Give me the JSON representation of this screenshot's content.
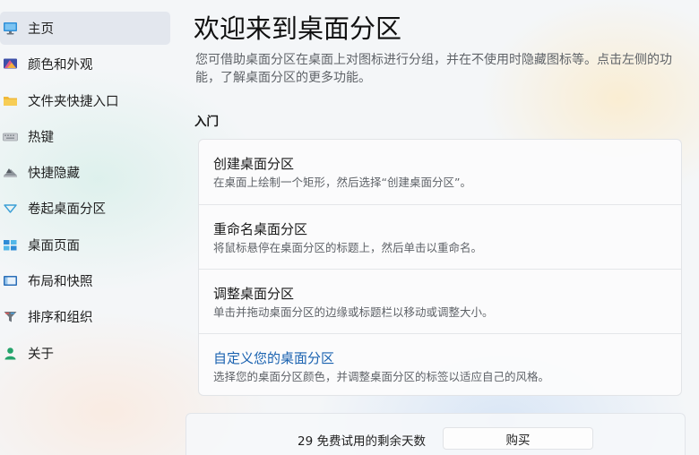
{
  "sidebar": {
    "items": [
      {
        "label": "主页",
        "icon": "monitor-icon",
        "active": true
      },
      {
        "label": "颜色和外观",
        "icon": "palette-icon"
      },
      {
        "label": "文件夹快捷入口",
        "icon": "folder-icon"
      },
      {
        "label": "热键",
        "icon": "keyboard-icon"
      },
      {
        "label": "快捷隐藏",
        "icon": "quick-hide-icon"
      },
      {
        "label": "卷起桌面分区",
        "icon": "rollup-icon"
      },
      {
        "label": "桌面页面",
        "icon": "desktop-pages-icon"
      },
      {
        "label": "布局和快照",
        "icon": "layout-icon"
      },
      {
        "label": "排序和组织",
        "icon": "sort-filter-icon"
      },
      {
        "label": "关于",
        "icon": "person-icon"
      }
    ]
  },
  "main": {
    "title": "欢迎来到桌面分区",
    "intro": "您可借助桌面分区在桌面上对图标进行分组，并在不使用时隐藏图标等。点击左侧的功能，了解桌面分区的更多功能。",
    "section_heading": "入门",
    "features": [
      {
        "title": "创建桌面分区",
        "description": "在桌面上绘制一个矩形，然后选择“创建桌面分区”。"
      },
      {
        "title": "重命名桌面分区",
        "description": "将鼠标悬停在桌面分区的标题上，然后单击以重命名。"
      },
      {
        "title": "调整桌面分区",
        "description": "单击并拖动桌面分区的边缘或标题栏以移动或调整大小。"
      },
      {
        "title": "自定义您的桌面分区",
        "description": "选择您的桌面分区颜色，并调整桌面分区的标签以适应自己的风格。",
        "link": true
      }
    ]
  },
  "trial": {
    "days_text": "29 免费试用的剩余天数",
    "buy_label": "购买"
  },
  "colors": {
    "link": "#1a62b0",
    "active_nav": "#e1e6ec"
  }
}
